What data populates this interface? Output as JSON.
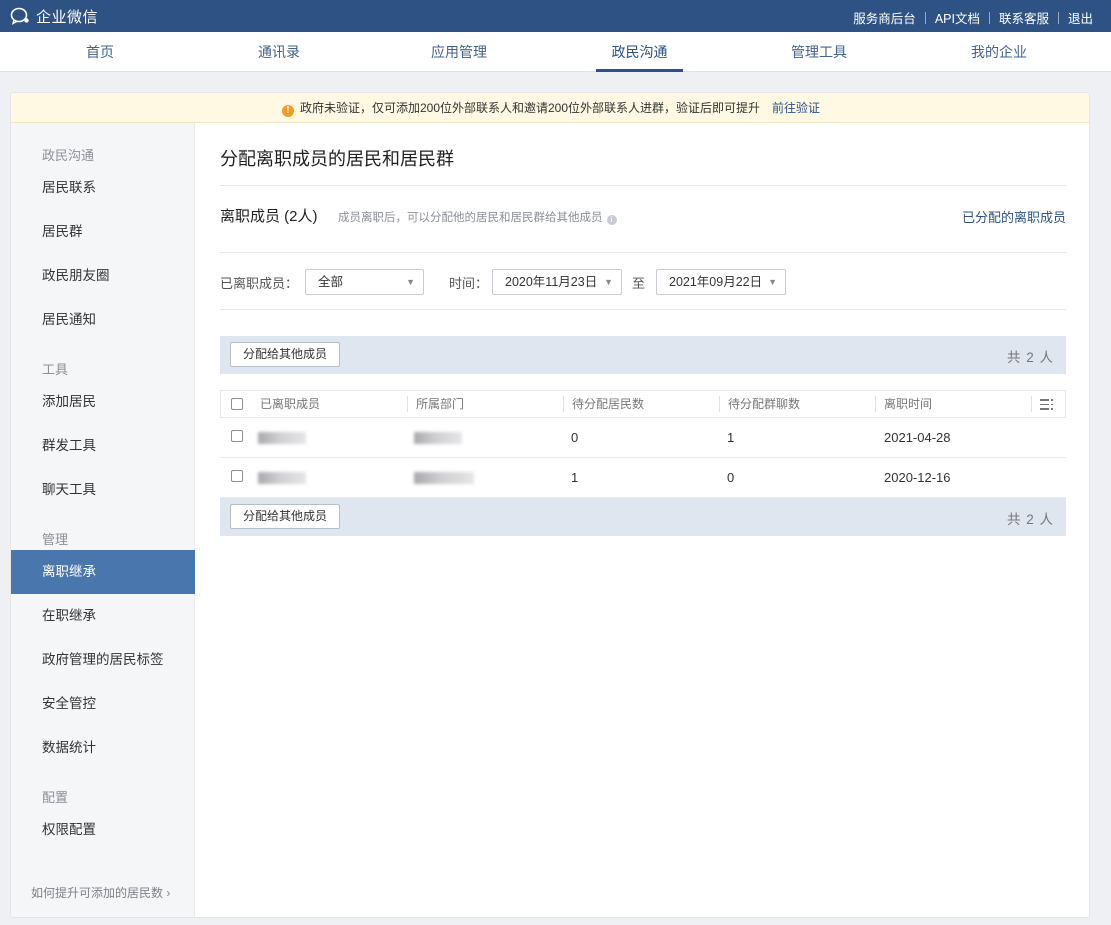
{
  "topbar": {
    "logo_text": "企业微信",
    "links": [
      "服务商后台",
      "API文档",
      "联系客服",
      "退出"
    ]
  },
  "nav": {
    "items": [
      "首页",
      "通讯录",
      "应用管理",
      "政民沟通",
      "管理工具",
      "我的企业"
    ],
    "active": "政民沟通"
  },
  "notice": {
    "text": "政府未验证，仅可添加200位外部联系人和邀请200位外部联系人进群，验证后即可提升",
    "link": "前往验证"
  },
  "sidebar": {
    "categories": [
      "政民沟通",
      "工具",
      "管理",
      "配置"
    ],
    "items": [
      "居民联系",
      "居民群",
      "政民朋友圈",
      "居民通知",
      "添加居民",
      "群发工具",
      "聊天工具",
      "离职继承",
      "在职继承",
      "政府管理的居民标签",
      "安全管控",
      "数据统计",
      "权限配置"
    ],
    "active": "离职继承",
    "footer": "如何提升可添加的居民数"
  },
  "content": {
    "title": "分配离职成员的居民和居民群",
    "section_title": "离职成员 (2人)",
    "section_desc": "成员离职后，可以分配他的居民和居民群给其他成员",
    "assigned_link": "已分配的离职成员",
    "filter": {
      "member_label": "已离职成员：",
      "member_value": "全部",
      "time_label": "时间：",
      "date_from": "2020年11月23日",
      "to_label": "至",
      "date_to": "2021年09月22日"
    },
    "assign_button": "分配给其他成员",
    "total": "共 2 人",
    "table": {
      "headers": [
        "已离职成员",
        "所属部门",
        "待分配居民数",
        "待分配群聊数",
        "离职时间"
      ],
      "rows": [
        {
          "pending_residents": "0",
          "pending_groups": "1",
          "leave_time": "2021-04-28"
        },
        {
          "pending_residents": "1",
          "pending_groups": "0",
          "leave_time": "2020-12-16"
        }
      ]
    }
  }
}
